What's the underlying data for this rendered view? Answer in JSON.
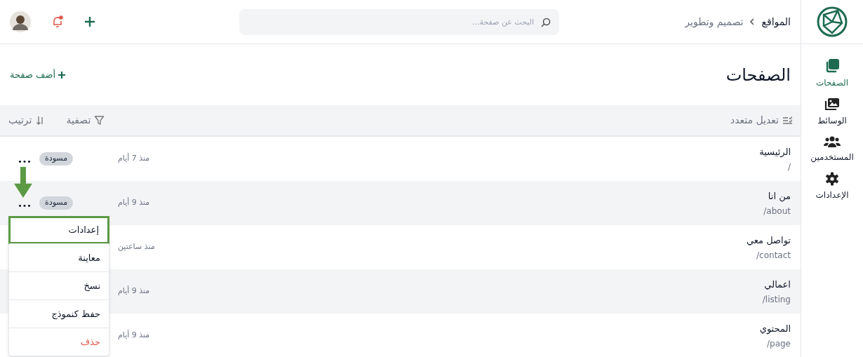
{
  "sidebar": {
    "items": [
      {
        "label": "الصفحات",
        "kind": "pages",
        "selected": true
      },
      {
        "label": "الوسائط",
        "kind": "media",
        "selected": false
      },
      {
        "label": "المستخدمين",
        "kind": "users",
        "selected": false
      },
      {
        "label": "الإعدادات",
        "kind": "settings",
        "selected": false
      }
    ]
  },
  "breadcrumb": [
    "المواقع",
    "تصميم وتطوير"
  ],
  "search": {
    "placeholder": "البحث عن صفحة..."
  },
  "notifications": {
    "unread": true
  },
  "page_title": "الصفحات",
  "add_page_button": "أضف صفحة",
  "toolbar": {
    "bulk_edit": "تعديل متعدد",
    "filter": "تصفية",
    "sort": "ترتيب"
  },
  "rows": [
    {
      "title": "الرئيسية",
      "slug": "/",
      "time": "منذ 7 أيام",
      "badge": "مسودة",
      "actions": "•••"
    },
    {
      "title": "من انا",
      "slug": "/about",
      "time": "منذ 9 أيام",
      "badge": "مسودة",
      "actions": "•••"
    },
    {
      "title": "تواصل معي",
      "slug": "/contact",
      "time": "منذ ساعتين"
    },
    {
      "title": "اعمالي",
      "slug": "/listing",
      "time": "منذ 9 أيام"
    },
    {
      "title": "المحتوي",
      "slug": "/page",
      "time": "منذ 9 أيام"
    }
  ],
  "row_menu": {
    "items": [
      {
        "label": "إعدادات",
        "selected": true,
        "kind": "normal"
      },
      {
        "label": "معاينة",
        "selected": false,
        "kind": "normal"
      },
      {
        "label": "نسخ",
        "selected": false,
        "kind": "normal"
      },
      {
        "label": "حفظ كنموذج",
        "selected": false,
        "kind": "normal"
      },
      {
        "label": "حذف",
        "selected": false,
        "kind": "danger"
      }
    ]
  }
}
